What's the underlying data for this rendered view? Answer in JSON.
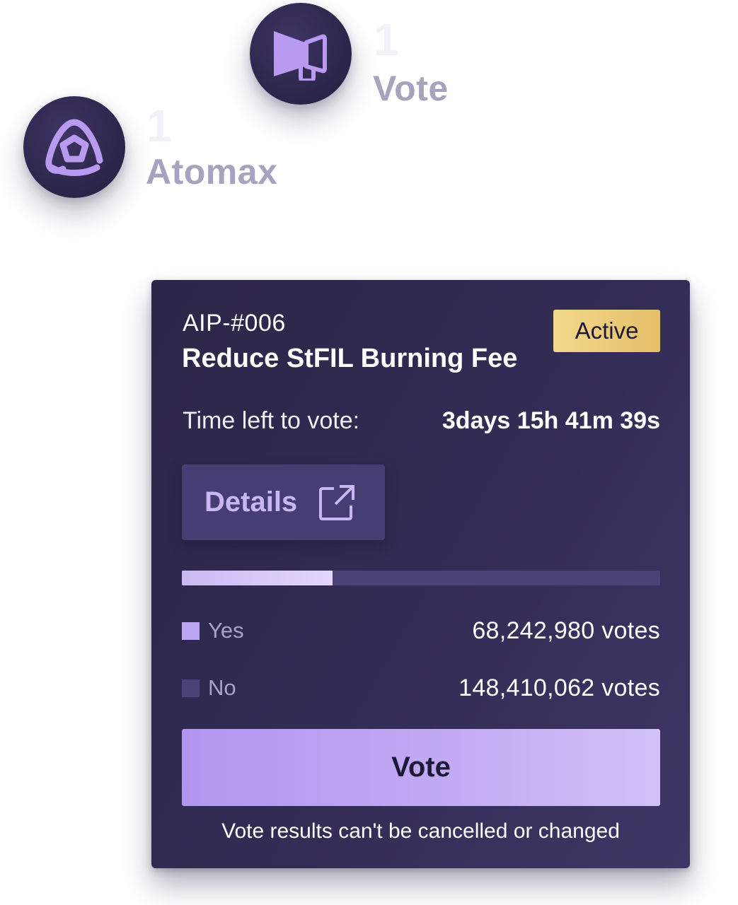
{
  "steps": [
    {
      "id": "vote",
      "count": "1",
      "label": "Vote",
      "icon": "megaphone-icon"
    },
    {
      "id": "atomax",
      "count": "1",
      "label": "Atomax",
      "icon": "atomax-logo-icon"
    }
  ],
  "proposal": {
    "id": "AIP-#006",
    "title": "Reduce StFIL Burning Fee",
    "status": "Active",
    "time_left_label": "Time left to vote:",
    "time_left_value": "3days 15h 41m 39s",
    "details_label": "Details",
    "details_icon": "external-link-icon",
    "yes_share": 0.315,
    "options": [
      {
        "name": "Yes",
        "votes": "68,242,980 votes",
        "color": "#bda6f1"
      },
      {
        "name": "No",
        "votes": "148,410,062 votes",
        "color": "#4b4377"
      }
    ],
    "vote_button_label": "Vote",
    "disclaimer": "Vote results can't be cancelled or changed"
  },
  "colors": {
    "card_bg": "#332c55",
    "accent_purple": "#b196f0",
    "badge_gold": "#e9c874",
    "muted_label": "#a7a2bd"
  }
}
